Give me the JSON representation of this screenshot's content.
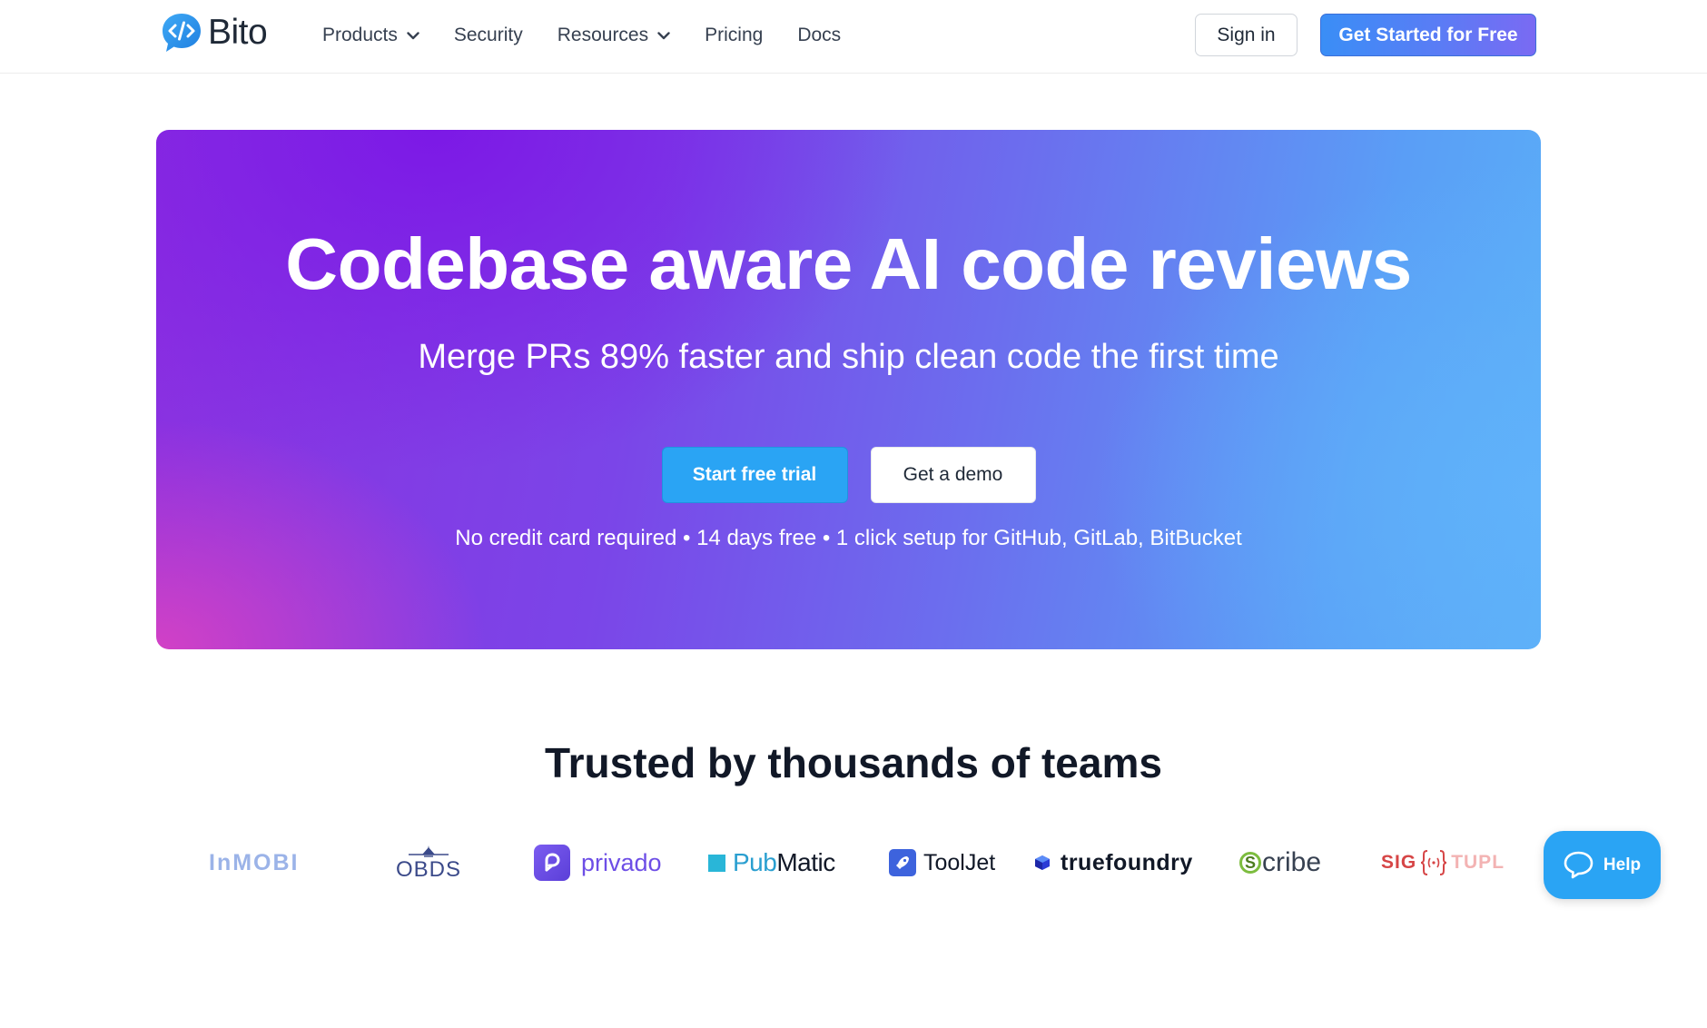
{
  "header": {
    "logo_text": "Bito",
    "nav": [
      {
        "label": "Products",
        "has_dropdown": true
      },
      {
        "label": "Security",
        "has_dropdown": false
      },
      {
        "label": "Resources",
        "has_dropdown": true
      },
      {
        "label": "Pricing",
        "has_dropdown": false
      },
      {
        "label": "Docs",
        "has_dropdown": false
      }
    ],
    "sign_in_label": "Sign in",
    "get_started_label": "Get Started for Free"
  },
  "hero": {
    "title": "Codebase aware AI code reviews",
    "subtitle": "Merge PRs 89% faster and ship clean code the first time",
    "primary_button": "Start free trial",
    "secondary_button": "Get a demo",
    "note": "No credit card required • 14 days free • 1 click setup for GitHub, GitLab, BitBucket"
  },
  "trusted": {
    "title": "Trusted by thousands of teams",
    "logos": [
      {
        "name": "InMobi",
        "text": "InMOBI"
      },
      {
        "name": "OBDS",
        "text": "OBDS"
      },
      {
        "name": "Privado",
        "text": "privado"
      },
      {
        "name": "PubMatic",
        "text_a": "Pub",
        "text_b": "Matic"
      },
      {
        "name": "ToolJet",
        "text": "ToolJet"
      },
      {
        "name": "TrueFoundry",
        "text": "truefoundry"
      },
      {
        "name": "Scribe",
        "text_s": "S",
        "text": "cribe"
      },
      {
        "name": "SigTuple",
        "text_a": "SIG",
        "text_b": "TUPL"
      }
    ]
  },
  "help": {
    "label": "Help"
  },
  "colors": {
    "brand_blue": "#2aa4f4",
    "hero_purple": "#7c17e6",
    "hero_blue": "#5bb0f8",
    "hero_pink": "#d642c4"
  },
  "icons": {
    "logo": "code-chat-icon",
    "dropdown": "chevron-down-icon",
    "help": "chat-bubble-icon"
  }
}
